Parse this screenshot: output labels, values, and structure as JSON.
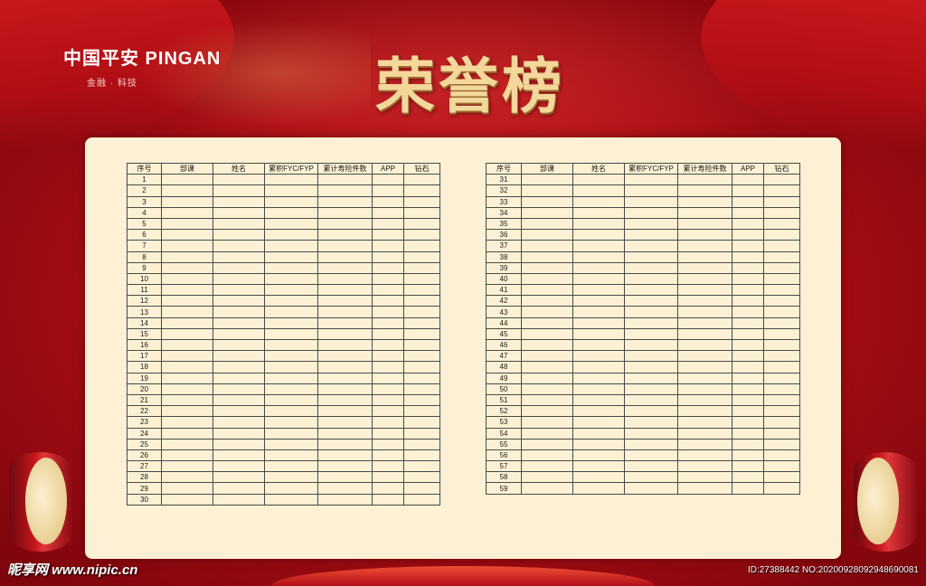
{
  "brand": {
    "logo": "中国平安 PINGAN",
    "tagline": "金融 · 科技"
  },
  "title": "荣誉榜",
  "table": {
    "columns": [
      "序号",
      "部课",
      "姓名",
      "累积FYC/FYP",
      "累计寿险件数",
      "APP",
      "钻石"
    ],
    "left_rows": [
      "1",
      "2",
      "3",
      "4",
      "5",
      "6",
      "7",
      "8",
      "9",
      "10",
      "11",
      "12",
      "13",
      "14",
      "15",
      "16",
      "17",
      "18",
      "19",
      "20",
      "21",
      "22",
      "23",
      "24",
      "25",
      "26",
      "27",
      "28",
      "29",
      "30"
    ],
    "right_rows": [
      "31",
      "32",
      "33",
      "34",
      "35",
      "36",
      "37",
      "38",
      "39",
      "40",
      "41",
      "42",
      "43",
      "44",
      "45",
      "46",
      "47",
      "48",
      "49",
      "50",
      "51",
      "52",
      "53",
      "54",
      "55",
      "56",
      "57",
      "58",
      "59"
    ]
  },
  "watermark": {
    "left": "昵享网 www.nipic.cn",
    "right": "ID:27388442 NO:20200928092948690081"
  },
  "colors": {
    "background": "#b01218",
    "board": "#fcf1d4",
    "title_gold": "#f4d79b"
  }
}
